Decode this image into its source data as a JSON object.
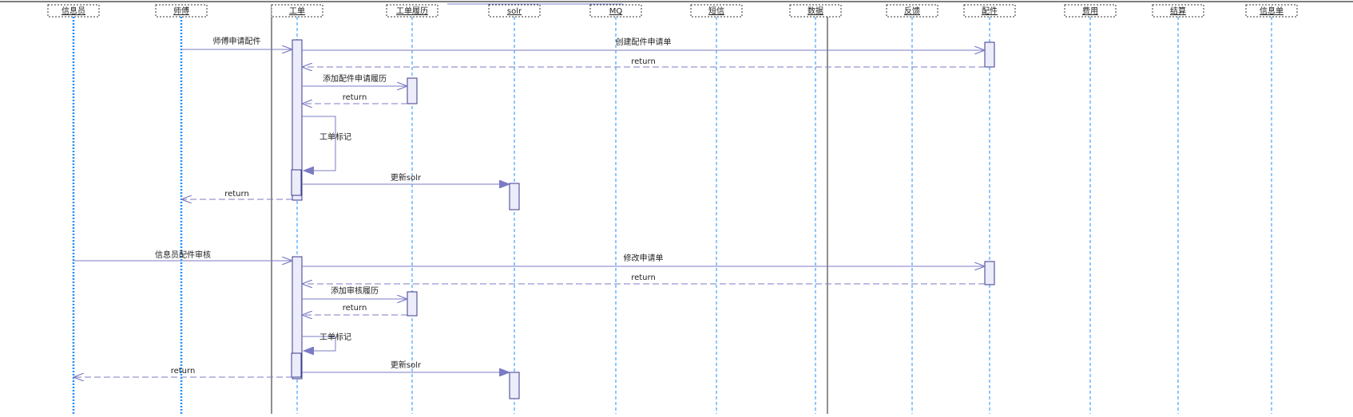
{
  "diagram": {
    "type": "sequence",
    "lifelines": [
      {
        "id": "xinxiyuan",
        "label": "信息员"
      },
      {
        "id": "shifu",
        "label": "师傅"
      },
      {
        "id": "gongdan",
        "label": "工单"
      },
      {
        "id": "gongdanlvli",
        "label": "工单履历"
      },
      {
        "id": "solr",
        "label": "solr"
      },
      {
        "id": "mq",
        "label": "MQ"
      },
      {
        "id": "duanxin",
        "label": "短信"
      },
      {
        "id": "shuju",
        "label": "数据"
      },
      {
        "id": "fankui",
        "label": "反馈"
      },
      {
        "id": "peijian",
        "label": "配件"
      },
      {
        "id": "feiyong",
        "label": "费用"
      },
      {
        "id": "jiesuan",
        "label": "结算"
      },
      {
        "id": "xinxidan",
        "label": "信息单"
      }
    ],
    "messages": [
      {
        "id": "m1",
        "from": "shifu",
        "to": "gongdan",
        "kind": "call",
        "label": "师傅申请配件"
      },
      {
        "id": "m2",
        "from": "gongdan",
        "to": "peijian",
        "kind": "call",
        "label": "创建配件申请单"
      },
      {
        "id": "m3",
        "from": "peijian",
        "to": "gongdan",
        "kind": "return",
        "label": "return"
      },
      {
        "id": "m4",
        "from": "gongdan",
        "to": "gongdanlvli",
        "kind": "call",
        "label": "添加配件申请履历"
      },
      {
        "id": "m5",
        "from": "gongdanlvli",
        "to": "gongdan",
        "kind": "return",
        "label": "return"
      },
      {
        "id": "m6",
        "from": "gongdan",
        "to": "gongdan",
        "kind": "self",
        "label": "工单标记"
      },
      {
        "id": "m7",
        "from": "gongdan",
        "to": "solr",
        "kind": "async",
        "label": "更新solr"
      },
      {
        "id": "m8",
        "from": "gongdan",
        "to": "shifu",
        "kind": "return",
        "label": "return"
      },
      {
        "id": "m9",
        "from": "xinxiyuan",
        "to": "gongdan",
        "kind": "call",
        "label": "信息员配件审核"
      },
      {
        "id": "m10",
        "from": "gongdan",
        "to": "peijian",
        "kind": "call",
        "label": "修改申请单"
      },
      {
        "id": "m11",
        "from": "peijian",
        "to": "gongdan",
        "kind": "return",
        "label": "return"
      },
      {
        "id": "m12",
        "from": "gongdan",
        "to": "gongdanlvli",
        "kind": "call",
        "label": "添加审核履历"
      },
      {
        "id": "m13",
        "from": "gongdanlvli",
        "to": "gongdan",
        "kind": "return",
        "label": "return"
      },
      {
        "id": "m14",
        "from": "gongdan",
        "to": "gongdan",
        "kind": "self",
        "label": "工单标记"
      },
      {
        "id": "m15",
        "from": "gongdan",
        "to": "solr",
        "kind": "async",
        "label": "更新solr"
      },
      {
        "id": "m16",
        "from": "gongdan",
        "to": "xinxiyuan",
        "kind": "return",
        "label": "return"
      }
    ]
  },
  "colors": {
    "lifeline": "#1e90ff",
    "arrow": "#7b7bc4",
    "activation_fill": "#ececfb",
    "activation_stroke": "#3a3a8c",
    "header_border": "#333333",
    "frame": "#222222",
    "label_text": "#222222"
  }
}
